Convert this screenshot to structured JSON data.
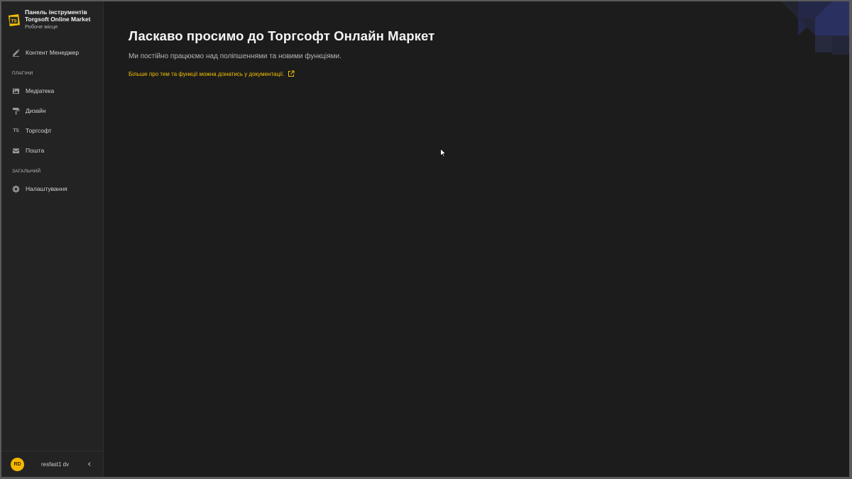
{
  "brand": {
    "title_line1": "Панель інструментів",
    "title_line2": "Torgsoft Online Market",
    "subtitle": "Робоче місце",
    "logo_text": "TS"
  },
  "sidebar": {
    "top_items": [
      {
        "label": "Контент Менеджер",
        "icon": "edit-icon"
      }
    ],
    "sections": [
      {
        "label": "ПЛАГІНИ",
        "items": [
          {
            "label": "Медіатека",
            "icon": "image-icon"
          },
          {
            "label": "Дизайн",
            "icon": "paint-roller-icon"
          },
          {
            "label": "Торгсофт",
            "icon": "ts-icon"
          },
          {
            "label": "Пошта",
            "icon": "mail-icon"
          }
        ]
      },
      {
        "label": "ЗАГАЛЬНИЙ",
        "items": [
          {
            "label": "Налаштування",
            "icon": "gear-icon"
          }
        ]
      }
    ]
  },
  "user": {
    "initials": "RD",
    "name": "resfast1 dv"
  },
  "main": {
    "title": "Ласкаво просимо до Торгсофт Онлайн Маркет",
    "subtitle": "Ми постійно працюємо над поліпшеннями та новими функціями.",
    "doc_link": "Більше про тем та функції можна дізнатись у документації."
  },
  "colors": {
    "accent": "#f5c000",
    "background": "#1c1c1c",
    "sidebar": "#232323"
  }
}
